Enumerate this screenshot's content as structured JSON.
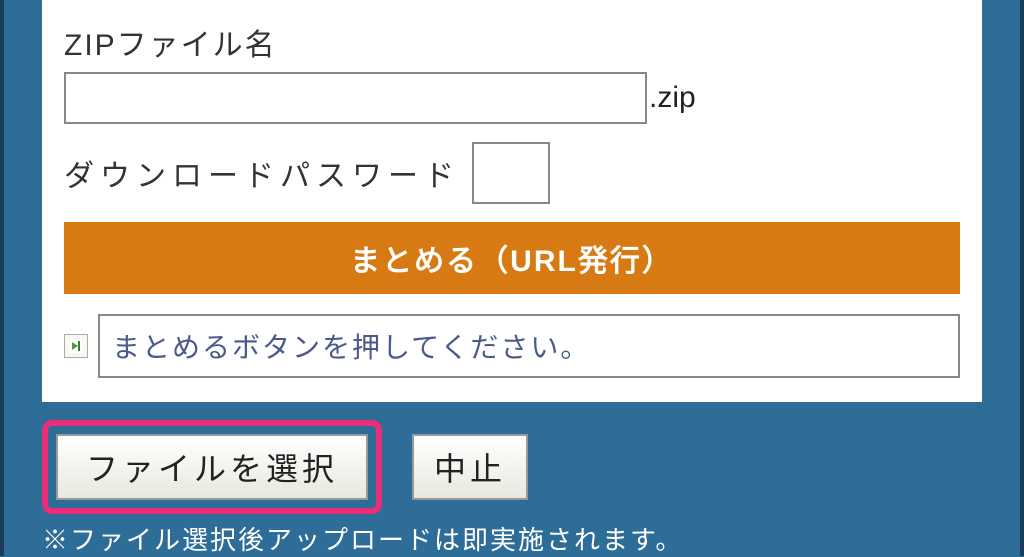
{
  "form": {
    "zip_label": "ZIPファイル名",
    "zip_value": "",
    "zip_suffix": ".zip",
    "password_label": "ダウンロードパスワード",
    "password_value": "",
    "combine_button": "まとめる（URL発行）",
    "status_message": "まとめるボタンを押してください。"
  },
  "controls": {
    "file_select": "ファイルを選択",
    "cancel": "中止",
    "note": "※ファイル選択後アップロードは即実施されます。"
  }
}
